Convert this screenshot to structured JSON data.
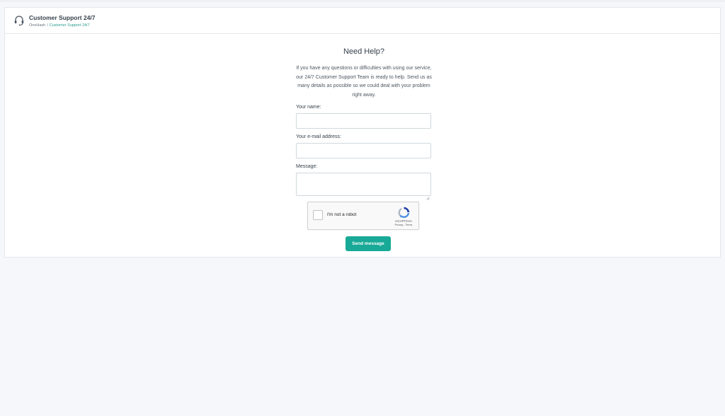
{
  "header": {
    "title": "Customer Support 24/7",
    "breadcrumb": {
      "root": "OneHash",
      "separator": "/",
      "current": "Customer Support 24/7"
    },
    "icon": "headset-icon"
  },
  "form": {
    "heading": "Need Help?",
    "intro": "If you have any questions or difficulties with using our service, our 24/7 Customer Support Team is ready to help. Send us as many details as possible so we could deal with your problem right away.",
    "name_label": "Your name:",
    "name_value": "",
    "email_label": "Your e-mail address:",
    "email_value": "",
    "message_label": "Message:",
    "message_value": "",
    "send_label": "Send message"
  },
  "captcha": {
    "label": "I'm not a robot",
    "brand": "reCAPTCHA",
    "links": "Privacy - Terms",
    "checked": false
  },
  "colors": {
    "accent": "#18a997",
    "breadcrumb_link": "#2a9d8f",
    "page_background": "#f6f7fa",
    "card_background": "#ffffff"
  }
}
